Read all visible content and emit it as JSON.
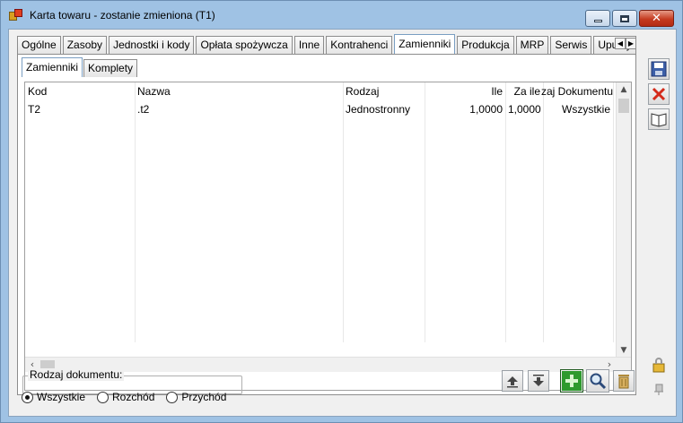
{
  "window": {
    "title": "Karta towaru - zostanie zmieniona (T1)"
  },
  "tabs": [
    "Ogólne",
    "Zasoby",
    "Jednostki i kody",
    "Opłata spożywcza",
    "Inne",
    "Kontrahenci",
    "Zamienniki",
    "Produkcja",
    "MRP",
    "Serwis",
    "Upusty"
  ],
  "active_tab": "Zamienniki",
  "subtabs": [
    "Zamienniki",
    "Komplety"
  ],
  "active_subtab": "Zamienniki",
  "grid": {
    "columns": [
      "Kod",
      "Nazwa",
      "Rodzaj",
      "Ile",
      "Za ile",
      "zaj Dokumentu"
    ],
    "rows": [
      [
        "T2",
        ".t2",
        "Jednostronny",
        "1,0000",
        "1,0000",
        "Wszystkie"
      ]
    ]
  },
  "document_type": {
    "label": "Rodzaj dokumentu:",
    "options": [
      "Wszystkie",
      "Rozchód",
      "Przychód"
    ],
    "selected": "Wszystkie"
  },
  "colors": {
    "frame": "#9fc2e4",
    "close_red": "#c53b20",
    "add_green": "#2e9a2e"
  },
  "icons": {
    "side": [
      "save-icon",
      "delete-icon",
      "book-icon"
    ],
    "bottom": [
      "move-up-icon",
      "move-down-icon",
      "add-icon",
      "search-icon",
      "trash-icon"
    ]
  }
}
